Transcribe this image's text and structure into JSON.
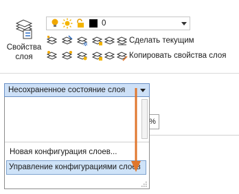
{
  "ribbon": {
    "layer_properties_label_line1": "Свойства",
    "layer_properties_label_line2": "слоя",
    "layer_combo_value": "0",
    "make_current_label": "Сделать текущим",
    "copy_properties_label": "Копировать свойства слоя"
  },
  "layer_state": {
    "current_value": "Несохраненное состояние слоя",
    "items": [
      "Новая конфигурация слоев...",
      "Управление конфигурациями слоев"
    ]
  },
  "background": {
    "field_fragment": "0%"
  },
  "colors": {
    "accent_selection": "#cde0f7",
    "arrow": "#e0762c",
    "bulb": "#f0a800",
    "layer_color_swatch": "#000000"
  },
  "icons": {
    "layer_properties": "layer-properties-icon",
    "bulb": "lightbulb-on-icon",
    "sun": "sun-thaw-icon",
    "lock": "padlock-icon",
    "make_current": "make-current-icon",
    "copy_properties": "copy-properties-icon"
  }
}
